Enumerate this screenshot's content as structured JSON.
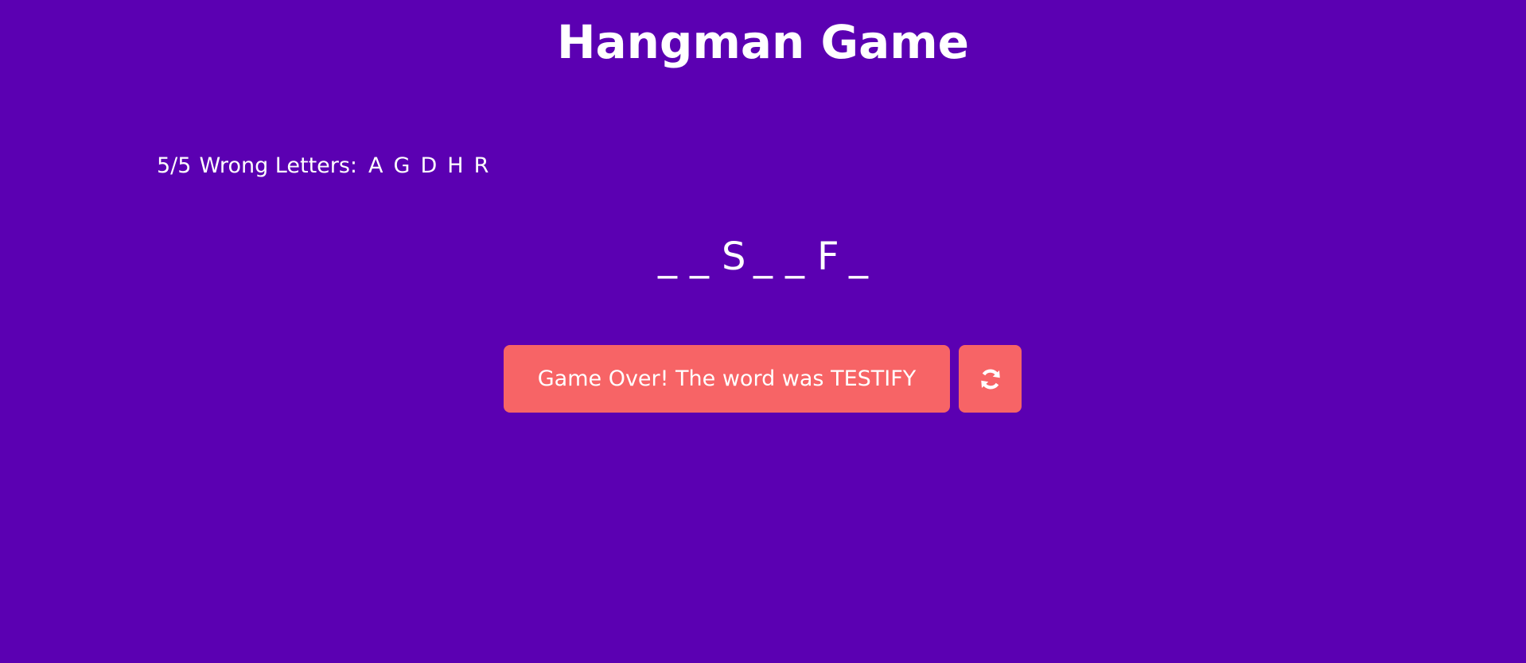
{
  "title": "Hangman Game",
  "wrong": {
    "count": "5/5",
    "label": "Wrong Letters:",
    "letters": [
      "A",
      "G",
      "D",
      "H",
      "R"
    ]
  },
  "word": {
    "slots": [
      "_",
      "_",
      "S",
      "_",
      "_",
      "F",
      "_"
    ]
  },
  "actions": {
    "status_text": "Game Over! The word was TESTIFY",
    "reset_icon": "refresh-icon"
  },
  "colors": {
    "background": "#5b00b2",
    "button": "#f76466",
    "text": "#ffffff"
  }
}
